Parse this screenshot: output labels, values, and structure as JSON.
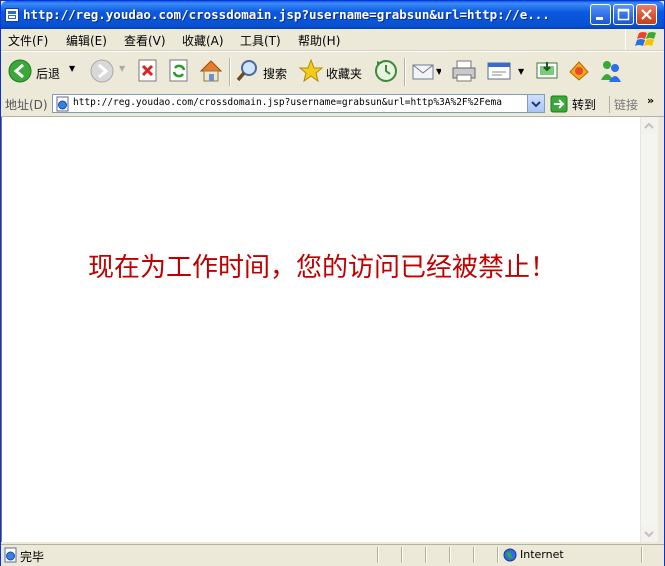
{
  "window": {
    "title": "http://reg.youdao.com/crossdomain.jsp?username=grabsun&url=http://e..."
  },
  "menu": [
    {
      "label": "文件(F)"
    },
    {
      "label": "编辑(E)"
    },
    {
      "label": "查看(V)"
    },
    {
      "label": "收藏(A)"
    },
    {
      "label": "工具(T)"
    },
    {
      "label": "帮助(H)"
    }
  ],
  "toolbar": {
    "back_label": "后退",
    "search_label": "搜索",
    "favorites_label": "收藏夹"
  },
  "address": {
    "label": "地址(D)",
    "url": "http://reg.youdao.com/crossdomain.jsp?username=grabsun&url=http%3A%2F%2Fema",
    "go_label": "转到",
    "links_label": "链接"
  },
  "content": {
    "message": "现在为工作时间，您的访问已经被禁止！"
  },
  "status": {
    "text": "完毕",
    "zone": "Internet"
  },
  "colors": {
    "titlebar": "#0b58df",
    "message": "#c00000",
    "chrome": "#ece9d8"
  }
}
